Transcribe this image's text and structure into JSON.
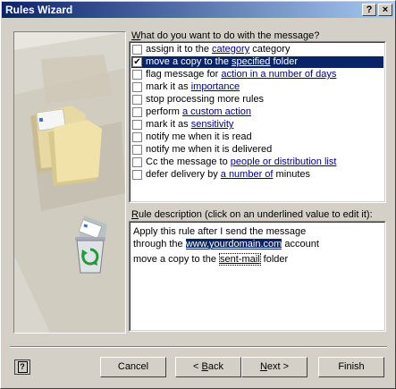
{
  "window": {
    "title": "Rules Wizard",
    "help_glyph": "?",
    "close_glyph": "×"
  },
  "question": {
    "prefix": "",
    "accel": "W",
    "rest": "hat do you want to do with the message?"
  },
  "actions": [
    {
      "checked": false,
      "selected": false,
      "pre": "assign it to the ",
      "link": "category",
      "post": " category"
    },
    {
      "checked": true,
      "selected": true,
      "pre": "move a copy to the ",
      "link": "specified",
      "post": " folder"
    },
    {
      "checked": false,
      "selected": false,
      "pre": "flag message for ",
      "link": "action in a number of days",
      "post": ""
    },
    {
      "checked": false,
      "selected": false,
      "pre": "mark it as ",
      "link": "importance",
      "post": ""
    },
    {
      "checked": false,
      "selected": false,
      "pre": "stop processing more rules",
      "link": "",
      "post": ""
    },
    {
      "checked": false,
      "selected": false,
      "pre": "perform ",
      "link": "a custom action",
      "post": ""
    },
    {
      "checked": false,
      "selected": false,
      "pre": "mark it as ",
      "link": "sensitivity",
      "post": ""
    },
    {
      "checked": false,
      "selected": false,
      "pre": "notify me when it is read",
      "link": "",
      "post": ""
    },
    {
      "checked": false,
      "selected": false,
      "pre": "notify me when it is delivered",
      "link": "",
      "post": ""
    },
    {
      "checked": false,
      "selected": false,
      "pre": "Cc the message to ",
      "link": "people or distribution list",
      "post": ""
    },
    {
      "checked": false,
      "selected": false,
      "pre": "defer delivery by ",
      "link": "a number of",
      "post": " minutes"
    }
  ],
  "description": {
    "label_accel": "R",
    "label_rest": "ule description (click on an underlined value to edit it):",
    "line1": "Apply this rule after I send the message",
    "line2_pre": "through the ",
    "line2_link": "www.yourdomain.com",
    "line2_post": " account",
    "line3_pre": "move a copy to the ",
    "line3_link": "sent-mail",
    "line3_post": " folder"
  },
  "buttons": {
    "cancel": "Cancel",
    "back_glyph": "< ",
    "back_accel": "B",
    "back_rest": "ack",
    "next_accel": "N",
    "next_rest": "ext >",
    "finish": "Finish",
    "help_glyph": "?"
  },
  "colors": {
    "title_start": "#0a246a",
    "title_end": "#a6caf0",
    "selection": "#0a246a",
    "link": "#000080",
    "face": "#d4d0c8"
  }
}
